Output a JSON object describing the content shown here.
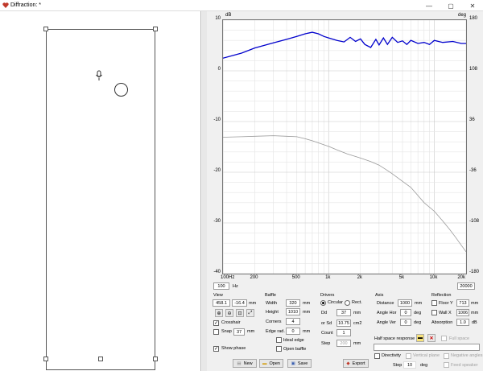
{
  "window": {
    "title": "Diffraction: *",
    "controls": [
      "—",
      "▢",
      "✕"
    ]
  },
  "chart_data": {
    "type": "line",
    "xscale": "log",
    "xlim": [
      100,
      20000
    ],
    "ylim_left": [
      -40,
      10
    ],
    "ylim_right": [
      -180,
      180
    ],
    "ylabel_left": "dB",
    "ylabel_right": "deg",
    "x_ticks": [
      "100Hz",
      "200",
      "500",
      "1k",
      "2k",
      "5k",
      "10k",
      "20k"
    ],
    "y_ticks_left": [
      "10",
      "0",
      "-10",
      "-20",
      "-30",
      "-40"
    ],
    "y_ticks_right": [
      "180",
      "108",
      "36",
      "-36",
      "-108",
      "-180"
    ],
    "grid": true,
    "series": [
      {
        "color": "#0000cc",
        "x": [
          100,
          150,
          200,
          300,
          400,
          500,
          600,
          700,
          800,
          900,
          1000,
          1200,
          1400,
          1600,
          1800,
          2000,
          2200,
          2500,
          2800,
          3000,
          3300,
          3600,
          4000,
          4500,
          5000,
          5500,
          6000,
          7000,
          8000,
          9000,
          10000,
          12000,
          15000,
          18000,
          20000
        ],
        "y": [
          2.5,
          3.5,
          4.5,
          5.5,
          6.2,
          6.8,
          7.3,
          7.6,
          7.3,
          6.8,
          6.5,
          6.0,
          5.7,
          6.6,
          5.8,
          6.3,
          5.2,
          4.6,
          6.2,
          5.1,
          6.5,
          5.2,
          6.6,
          5.6,
          5.9,
          5.2,
          6.0,
          5.4,
          5.6,
          5.2,
          6.0,
          5.6,
          5.8,
          5.4,
          5.4
        ]
      },
      {
        "color": "#999999",
        "x": [
          100,
          150,
          200,
          300,
          400,
          500,
          600,
          700,
          800,
          1000,
          1200,
          1500,
          2000,
          2500,
          3000,
          3500,
          4000,
          5000,
          6000,
          7000,
          8000,
          10000,
          12000,
          14000,
          16000,
          18000,
          20000
        ],
        "y": [
          -13.1,
          -13.0,
          -12.9,
          -12.8,
          -12.9,
          -13.0,
          -13.4,
          -13.8,
          -14.2,
          -14.9,
          -15.6,
          -16.4,
          -17.2,
          -17.9,
          -18.6,
          -19.5,
          -20.3,
          -21.8,
          -23.0,
          -24.6,
          -26.0,
          -27.7,
          -29.6,
          -31.3,
          -32.9,
          -34.4,
          -35.7
        ]
      }
    ]
  },
  "freq_range": {
    "min": "100",
    "unit": "Hz",
    "max": "20000"
  },
  "view": {
    "title": "View",
    "x": "458.1",
    "y": "-16.4",
    "unit": "mm",
    "crosshair_label": "Crosshair",
    "snap_label": "Snap",
    "snap_value": "37",
    "snap_unit": "mm",
    "show_phase_label": "Show phase"
  },
  "baffle": {
    "title": "Baffle",
    "width_label": "Width",
    "width": "320",
    "height_label": "Height",
    "height": "1010",
    "corners_label": "Corners",
    "corners": "4",
    "edge_label": "Edge rad.",
    "edge": "0",
    "unit": "mm",
    "ideal_edge_label": "Ideal edge",
    "open_baffle_label": "Open baffle"
  },
  "drivers": {
    "title": "Drivers",
    "circular_label": "Circular",
    "rect_label": "Rect.",
    "dd_label": "Dd",
    "dd": "37",
    "dd_unit": "mm",
    "sd_label": "or Sd",
    "sd": "10.75",
    "sd_unit": "cm2",
    "count_label": "Count",
    "count": "1",
    "step_label": "Step",
    "step": "200",
    "step_unit": "mm"
  },
  "axis": {
    "title": "Axis",
    "distance_label": "Distance",
    "distance": "1000",
    "distance_unit": "mm",
    "angle_hor_label": "Angle Hor",
    "angle_hor": "0",
    "angle_ver_label": "Angle Ver",
    "angle_ver": "0",
    "angle_unit": "deg"
  },
  "reflection": {
    "title": "Reflection",
    "floor_label": "Floor Y",
    "floor": "713",
    "wall_label": "Wall  X",
    "wall": "1006",
    "unit": "mm",
    "absorption_label": "Absorption",
    "absorption": "1.0",
    "absorption_unit": "dB"
  },
  "half_space": {
    "label": "Half space response",
    "full_space_label": "Full space"
  },
  "directivity": {
    "label": "Directivity",
    "vertical_plane": "Vertical plane",
    "negative_angles": "Negative angles",
    "step_label": "Step",
    "step": "10",
    "step_unit": "deg",
    "feed_speaker": "Feed speaker"
  },
  "actions": {
    "new": "New",
    "open": "Open",
    "save": "Save",
    "export": "Export"
  }
}
